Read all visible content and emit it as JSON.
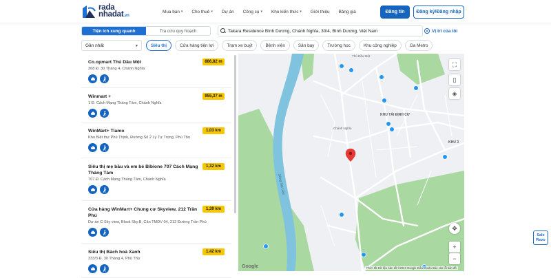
{
  "header": {
    "logo": {
      "line1": "rada",
      "line2": "nhadat",
      "suffix": ".vn"
    },
    "nav": [
      "Mua bán",
      "Cho thuê",
      "Dự án",
      "Công cụ",
      "Kho kiến thức",
      "Giới thiệu",
      "Bảng giá"
    ],
    "nav_has_dropdown": [
      true,
      true,
      false,
      true,
      true,
      false,
      false
    ],
    "login_label": "Đăng tin",
    "register_label": "Đăng ký/Đăng nhập"
  },
  "tabs": [
    {
      "label": "Tiện ích xung quanh",
      "active": true
    },
    {
      "label": "Tra cứu quy hoạch",
      "active": false
    }
  ],
  "search": {
    "value": "Takara Residence Bình Dương, Chánh Nghĩa, 30/4, Bình Dương, Việt Nam"
  },
  "locate_label": "Vị trí của tôi",
  "sort": {
    "value": "Gần nhất"
  },
  "chips": [
    {
      "label": "Siêu thị",
      "active": true
    },
    {
      "label": "Cửa hàng tiện lợi",
      "active": false
    },
    {
      "label": "Trạm xe buýt",
      "active": false
    },
    {
      "label": "Bệnh viện",
      "active": false
    },
    {
      "label": "Sân bay",
      "active": false
    },
    {
      "label": "Trường học",
      "active": false
    },
    {
      "label": "Khu công nghiệp",
      "active": false
    },
    {
      "label": "Ga Metro",
      "active": false
    }
  ],
  "places": [
    {
      "name": "Co.opmart Thủ Dầu Một",
      "address": "368 Đ. 30 Tháng 4, Chánh Nghĩa",
      "distance": "886,82 m"
    },
    {
      "name": "Winmart +",
      "address": "1 Đ. Cách Mạng Tháng Tám, Chánh Nghĩa",
      "distance": "955,37 m"
    },
    {
      "name": "WinMart+ Tiamo",
      "address": "Khu Biệt thự Phú Thịnh, Đường Số 2 Lý Tự Trọng, Phú Thọ",
      "distance": "1,03 km"
    },
    {
      "name": "Siêu thị mẹ bầu và em bé Bibione 707 Cách Mạng Tháng Tám",
      "address": "707 Đ. Cách Mạng Tháng Tám, Chánh Nghĩa",
      "distance": "1,32 km"
    },
    {
      "name": "Cửa hàng WinMart+ Chung cư Skyview, 212 Trần Phú",
      "address": "Dự án C-Sky view, Block Sky.B, Căn TMDV 04, 212 Đường Trần Phú",
      "distance": "1,39 km"
    },
    {
      "name": "Siêu thị Bách hoá Xanh",
      "address": "333/3 Đ. 30 Tháng 4, Phú Thọ",
      "distance": "1,42 km"
    }
  ],
  "map": {
    "labels": {
      "river": "Sông Sài Gòn",
      "khu_tai_dinh_cu": "KHU TÁI ĐỊNH CƯ",
      "khu3": "KHU 3",
      "chanh_nghia": "Chánh Nghĩa",
      "tdm": "Thủ Dầu Một",
      "google": "Google"
    },
    "attribution": "Phím tắt   Dữ liệu bản đồ ©2023 Google   Điều khoản   Báo cáo lỗi bản đồ",
    "colors": {
      "water": "#7fc3df",
      "park": "#a9d8a1",
      "road": "#ffffff",
      "land": "#eef0f3",
      "pin": "#e53935",
      "poi": "#2196f3"
    }
  },
  "sale_widget": {
    "line1": "Sale",
    "line2": "Revo"
  }
}
